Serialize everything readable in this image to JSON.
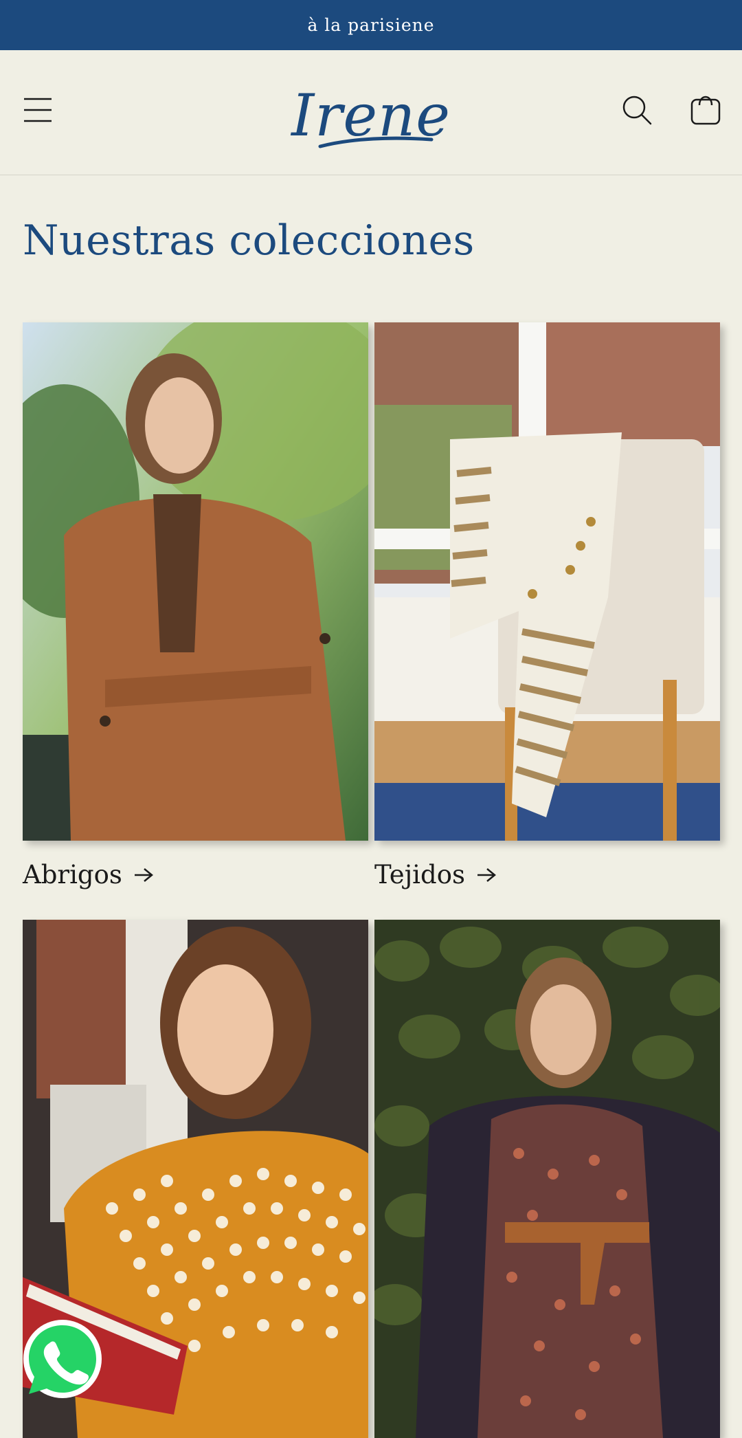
{
  "announcement": {
    "text": "à la parisiene"
  },
  "header": {
    "logo_text": "Irene",
    "menu_icon": "hamburger-menu-icon",
    "search_icon": "search-icon",
    "cart_icon": "shopping-bag-icon"
  },
  "collections": {
    "title": "Nuestras colecciones",
    "items": [
      {
        "label": "Abrigos",
        "image": "woman-in-camel-wool-coat-photo"
      },
      {
        "label": "Tejidos",
        "image": "striped-knit-sweater-on-chair-photo"
      },
      {
        "label": "",
        "image": "woman-in-floral-print-blouse-photo"
      },
      {
        "label": "",
        "image": "woman-in-floral-dress-with-belt-photo"
      }
    ]
  },
  "floating": {
    "whatsapp_icon": "whatsapp-icon"
  },
  "colors": {
    "brand_blue": "#1c4a7e",
    "background": "#f0efe4",
    "text": "#1a1a1a"
  }
}
